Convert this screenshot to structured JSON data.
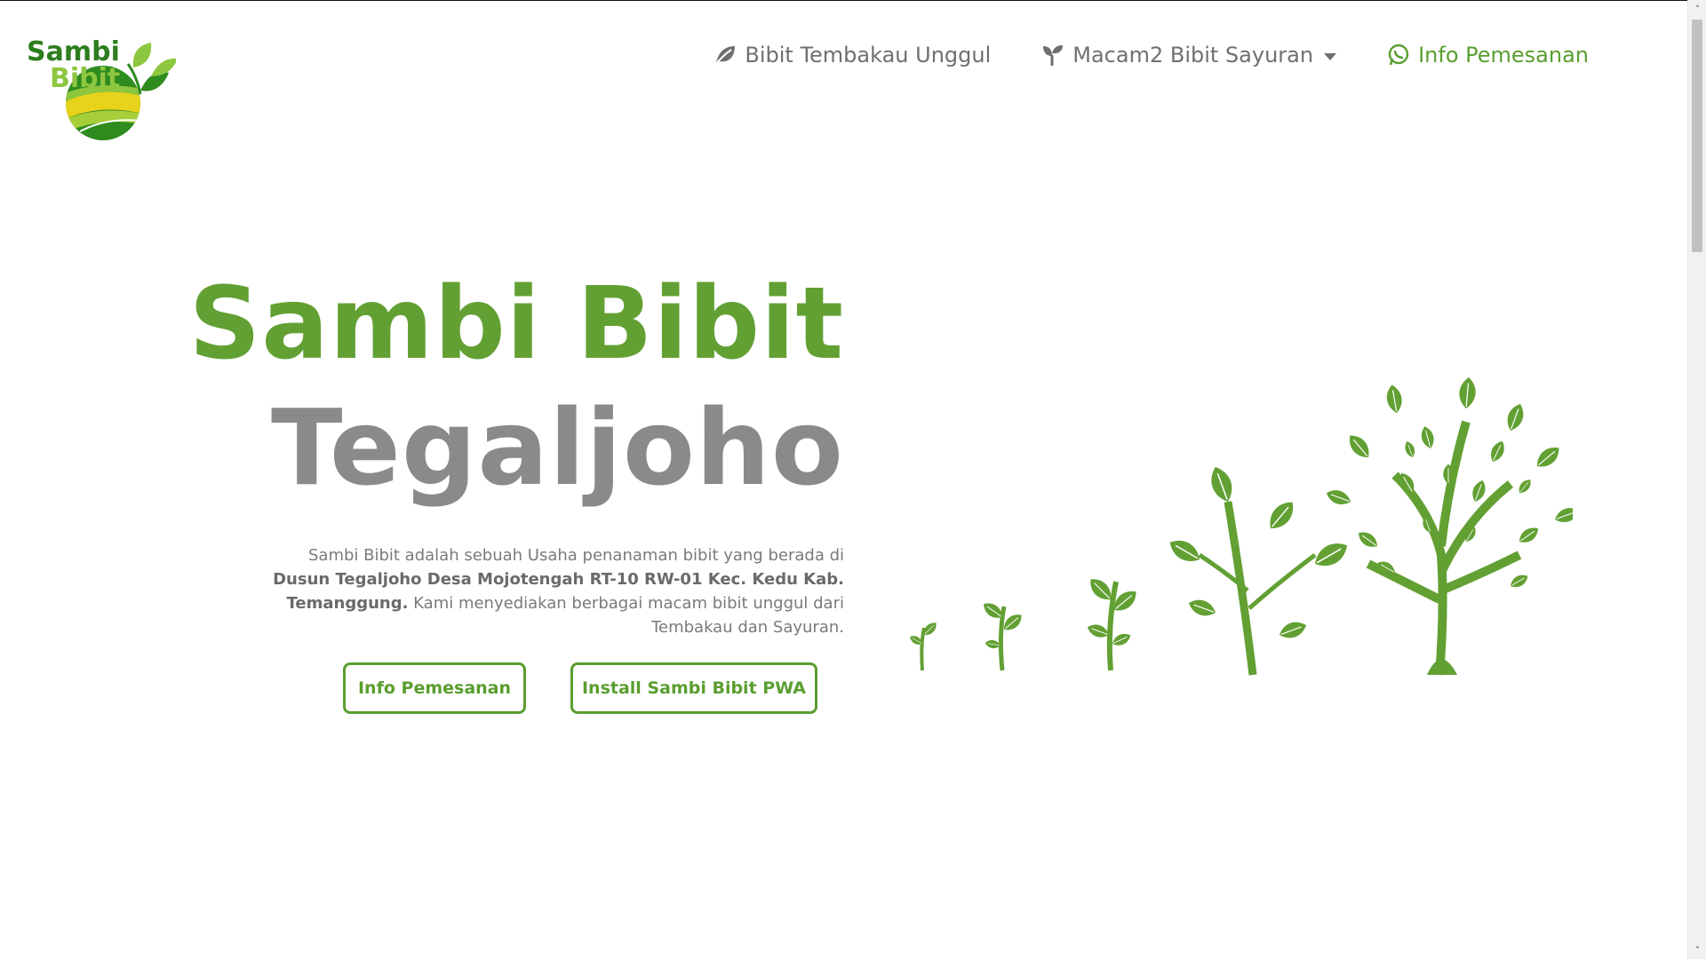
{
  "logo": {
    "line1": "Sambi",
    "line2": "Bibit",
    "colors": {
      "dark_green": "#2e7d1e",
      "light_green": "#8dc63f",
      "yellow": "#e8d21a"
    }
  },
  "nav": {
    "items": [
      {
        "label": "Bibit Tembakau Unggul",
        "icon": "leaf-icon"
      },
      {
        "label": "Macam2 Bibit Sayuran",
        "icon": "seedling-icon",
        "has_dropdown": true
      },
      {
        "label": "Info Pemesanan",
        "icon": "whatsapp-icon",
        "active": true
      }
    ]
  },
  "hero": {
    "title": "Sambi Bibit",
    "subtitle": "Tegaljoho",
    "desc_pre": "Sambi Bibit adalah sebuah Usaha penanaman bibit yang berada di ",
    "desc_bold": "Dusun Tegaljoho Desa Mojotengah RT-10 RW-01 Kec. Kedu Kab. Temanggung.",
    "desc_post": " Kami menyediakan berbagai macam bibit unggul dari Tembakau dan Sayuran."
  },
  "buttons": {
    "order": "Info Pemesanan",
    "install": "Install Sambi Bibit PWA"
  },
  "colors": {
    "brand_green": "#62a033",
    "accent_green": "#5a9e2f",
    "title_gray": "#8a8a8a"
  },
  "illustration": {
    "name": "plant-growth-stages",
    "stages": 5
  }
}
